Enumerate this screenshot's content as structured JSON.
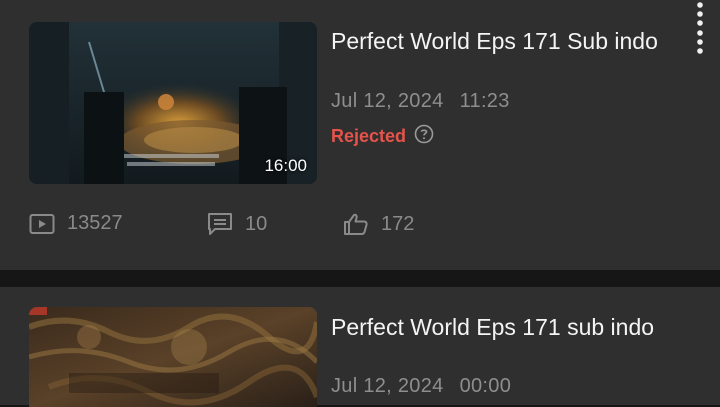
{
  "videos": [
    {
      "title": "Perfect World Eps 171 Sub indo",
      "date": "Jul 12, 2024",
      "time": "11:23",
      "status": "Rejected",
      "duration": "16:00",
      "views": "13527",
      "comments": "10",
      "likes": "172"
    },
    {
      "title": "Perfect World Eps 171 sub indo",
      "date": "Jul 12, 2024",
      "time": "00:00"
    }
  ],
  "icons": {
    "more": "more-vertical-icon",
    "help": "question-circle-icon",
    "views": "play-square-icon",
    "comments": "comment-icon",
    "likes": "thumbs-up-icon"
  },
  "colors": {
    "card_bg": "#2f2f2f",
    "divider": "#161616",
    "status_rejected": "#e5534b",
    "muted_text": "#8e8e8e"
  }
}
